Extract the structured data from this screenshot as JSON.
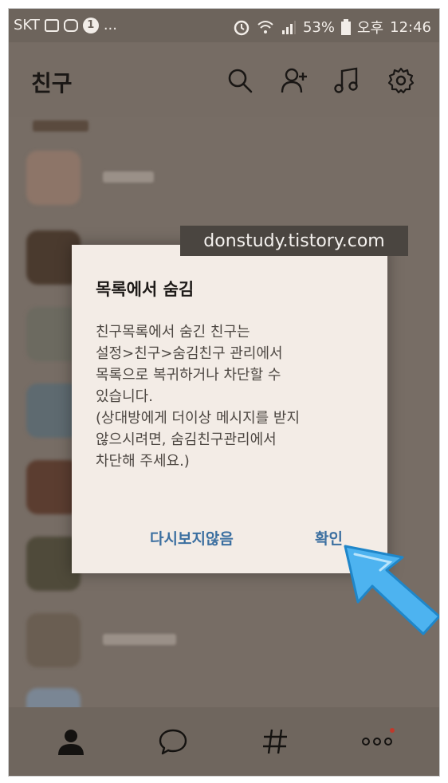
{
  "statusbar": {
    "carrier": "SKT",
    "left_extra": "1",
    "dots": "...",
    "battery": "53%",
    "ampm": "오후",
    "time": "12:46"
  },
  "header": {
    "title": "친구",
    "icons": [
      "search-icon",
      "add-friend-icon",
      "music-icon",
      "settings-icon"
    ]
  },
  "watermark": "donstudy.tistory.com",
  "dialog": {
    "title": "목록에서 숨김",
    "lines": [
      "친구목록에서 숨긴 친구는",
      "설정>친구>숨김친구 관리에서",
      "목록으로 복귀하거나 차단할 수",
      "있습니다.",
      "(상대방에게 더이상 메시지를 받지",
      "않으시려면, 숨김친구관리에서",
      "차단해 주세요.)"
    ],
    "secondary_button": "다시보지않음",
    "primary_button": "확인"
  },
  "bottom_nav": {
    "items": [
      "friends-icon",
      "chat-icon",
      "hashtag-icon",
      "more-icon"
    ]
  },
  "colors": {
    "accent": "#3b6fa0",
    "overlay": "#766c64",
    "dialog_bg": "#f3ece6",
    "arrow": "#4db3f0"
  }
}
